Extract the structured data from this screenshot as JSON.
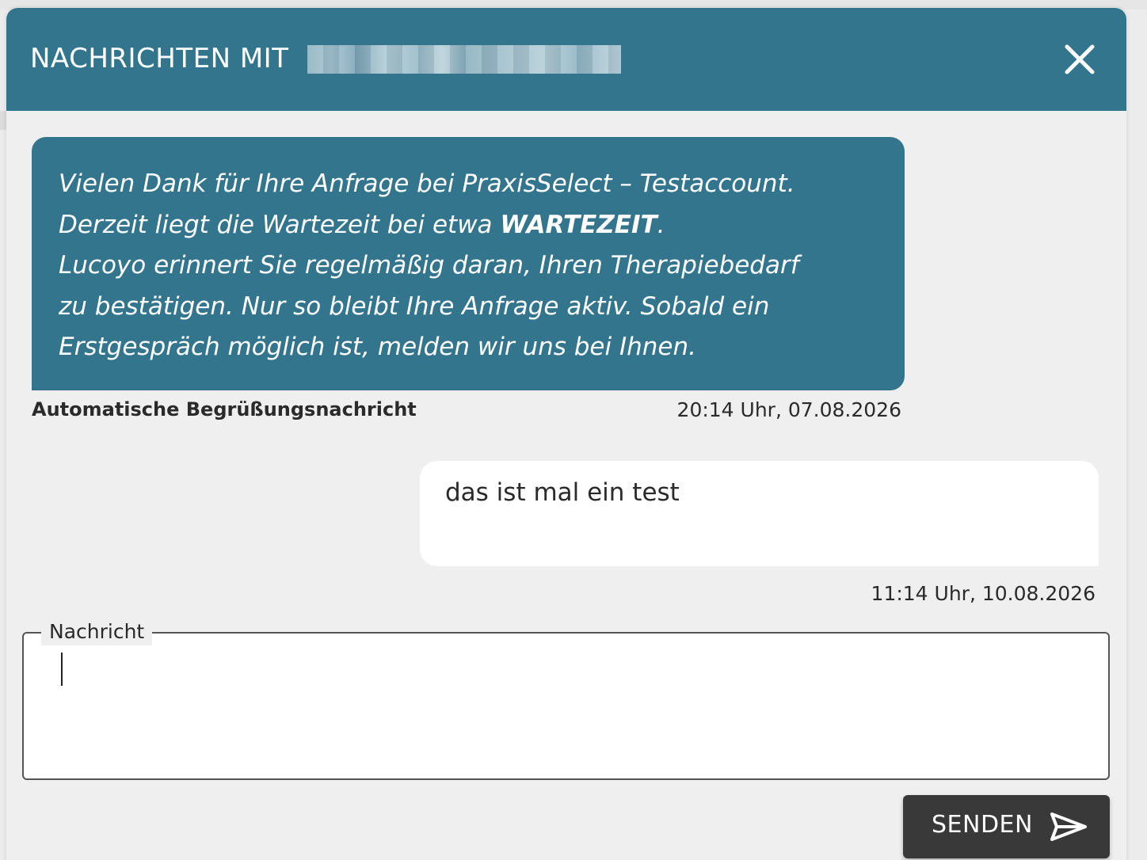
{
  "dialog": {
    "title": "NACHRICHTEN MIT",
    "close_icon": "close-icon"
  },
  "messages": [
    {
      "direction": "incoming",
      "lines": [
        "Vielen Dank für Ihre Anfrage bei PraxisSelect – Testaccount.",
        "Derzeit liegt die Wartezeit bei etwa ",
        "Lucoyo erinnert Sie regelmäßig daran, Ihren Therapiebedarf",
        "zu bestätigen. Nur so bleibt Ihre Anfrage aktiv. Sobald ein",
        "Erstgespräch möglich ist, melden wir uns bei Ihnen."
      ],
      "bold_word": "WARTEZEIT",
      "after_bold": ".",
      "sender": "Automatische Begrüßungsnachricht",
      "time": "20:14 Uhr, 07.08.2026"
    },
    {
      "direction": "outgoing",
      "text": "das ist mal ein test",
      "time": "11:14 Uhr, 10.08.2026"
    }
  ],
  "composer": {
    "label": "Nachricht",
    "value": ""
  },
  "send_button": {
    "label": "SENDEN",
    "icon": "send-icon"
  },
  "colors": {
    "header": "#33758d",
    "incoming_bubble": "#33758d",
    "outgoing_bubble": "#ffffff",
    "send_button": "#393939"
  }
}
